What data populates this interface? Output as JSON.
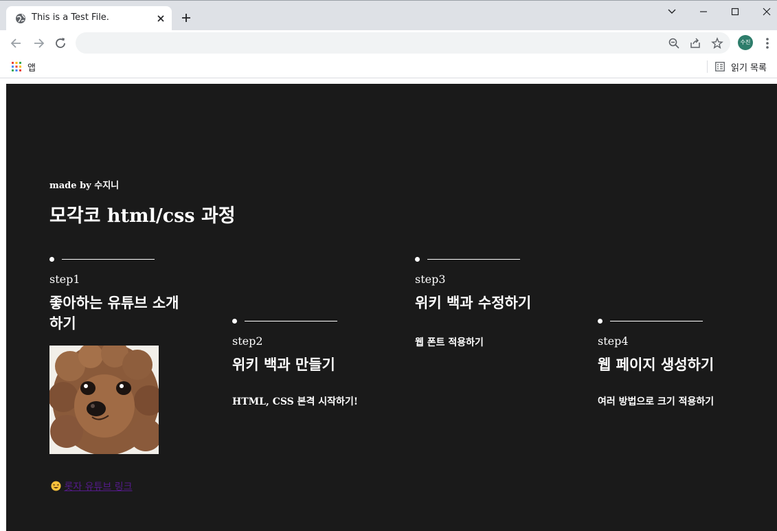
{
  "browser": {
    "tab_title": "This is a Test File.",
    "profile_initials": "수진",
    "bookmarks": {
      "apps_label": "앱",
      "reading_list_label": "읽기 목록"
    }
  },
  "page": {
    "made_by": "made by 수지니",
    "title": "모각코 html/css 과정",
    "steps": [
      {
        "label": "step1",
        "heading": "좋아하는 유튜브 소개하기"
      },
      {
        "label": "step2",
        "heading": "위키 백과 만들기",
        "desc": "HTML, CSS 본격 시작하기!"
      },
      {
        "label": "step3",
        "heading": "위키 백과 수정하기",
        "desc": "웹 폰트 적용하기"
      },
      {
        "label": "step4",
        "heading": "웹 페이지 생성하기",
        "desc": "여러 방법으로 크기 적용하기"
      }
    ],
    "link_text": "롯자 유튜브 링크"
  },
  "colors": {
    "page_bg": "#1a1a1a",
    "text": "#ffffff",
    "visited_link": "#551a8b"
  }
}
